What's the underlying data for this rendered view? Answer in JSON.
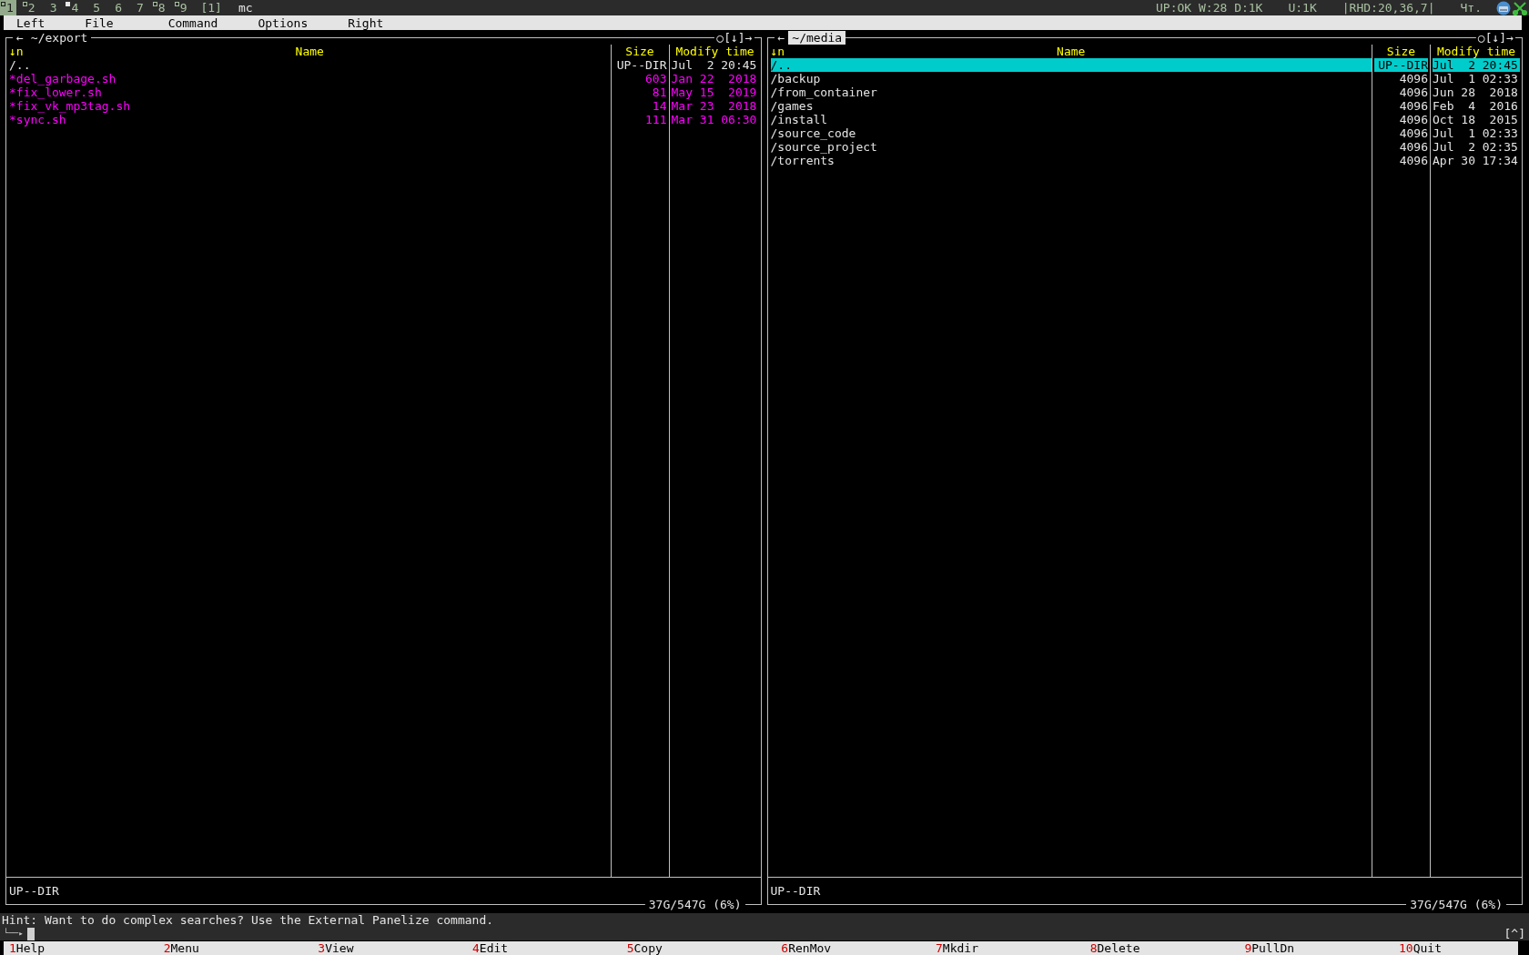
{
  "top_bar": {
    "workspaces": [
      {
        "label": "1",
        "selected": true,
        "occupied": true,
        "urgent": false
      },
      {
        "label": "2",
        "selected": false,
        "occupied": true,
        "urgent": false
      },
      {
        "label": "3",
        "selected": false,
        "occupied": false,
        "urgent": false
      },
      {
        "label": "4",
        "selected": false,
        "occupied": true,
        "urgent": true
      },
      {
        "label": "5",
        "selected": false,
        "occupied": false,
        "urgent": false
      },
      {
        "label": "6",
        "selected": false,
        "occupied": false,
        "urgent": false
      },
      {
        "label": "7",
        "selected": false,
        "occupied": false,
        "urgent": false
      },
      {
        "label": "8",
        "selected": false,
        "occupied": true,
        "urgent": false
      },
      {
        "label": "9",
        "selected": false,
        "occupied": true,
        "urgent": false
      }
    ],
    "layout": "[1]",
    "title": "mc",
    "status": [
      "UP:OK W:28 D:1K",
      "U:1K",
      "|RHD:20,36,7|",
      "Чт."
    ]
  },
  "menu": [
    "Left",
    "File",
    "Command",
    "Options",
    "Right"
  ],
  "panels": [
    {
      "path": "~/export",
      "active": false,
      "left_button": "←",
      "right_buttons": "○[↓]→",
      "sort": "↓n",
      "columns": [
        "Name",
        "Size",
        "Modify time"
      ],
      "rows": [
        {
          "name": "/..",
          "size": "UP--DIR",
          "modified": "Jul  2 20:45",
          "kind": "dir",
          "selected": false
        },
        {
          "name": "*del_garbage.sh",
          "size": "603",
          "modified": "Jan 22  2018",
          "kind": "executable",
          "selected": false
        },
        {
          "name": "*fix_lower.sh",
          "size": "81",
          "modified": "May 15  2019",
          "kind": "executable",
          "selected": false
        },
        {
          "name": "*fix_vk_mp3tag.sh",
          "size": "14",
          "modified": "Mar 23  2018",
          "kind": "executable",
          "selected": false
        },
        {
          "name": "*sync.sh",
          "size": "111",
          "modified": "Mar 31 06:30",
          "kind": "executable",
          "selected": false
        }
      ],
      "mini_status": "UP--DIR",
      "disk": "37G/547G (6%)"
    },
    {
      "path": "~/media",
      "active": true,
      "left_button": "←",
      "right_buttons": "○[↓]→",
      "sort": "↓n",
      "columns": [
        "Name",
        "Size",
        "Modify time"
      ],
      "rows": [
        {
          "name": "/..",
          "size": "UP--DIR",
          "modified": "Jul  2 20:45",
          "kind": "dir",
          "selected": true
        },
        {
          "name": "/backup",
          "size": "4096",
          "modified": "Jul  1 02:33",
          "kind": "dir",
          "selected": false
        },
        {
          "name": "/from_container",
          "size": "4096",
          "modified": "Jun 28  2018",
          "kind": "dir",
          "selected": false
        },
        {
          "name": "/games",
          "size": "4096",
          "modified": "Feb  4  2016",
          "kind": "dir",
          "selected": false
        },
        {
          "name": "/install",
          "size": "4096",
          "modified": "Oct 18  2015",
          "kind": "dir",
          "selected": false
        },
        {
          "name": "/source_code",
          "size": "4096",
          "modified": "Jul  1 02:33",
          "kind": "dir",
          "selected": false
        },
        {
          "name": "/source_project",
          "size": "4096",
          "modified": "Jul  2 02:35",
          "kind": "dir",
          "selected": false
        },
        {
          "name": "/torrents",
          "size": "4096",
          "modified": "Apr 30 17:34",
          "kind": "dir",
          "selected": false
        }
      ],
      "mini_status": "UP--DIR",
      "disk": "37G/547G (6%)"
    }
  ],
  "hint": "Hint: Want to do complex searches? Use the External Panelize command.",
  "command_line": {
    "prompt": "└──▸",
    "collapse": "[^]"
  },
  "keys": [
    {
      "num": "1",
      "label": "Help"
    },
    {
      "num": "2",
      "label": "Menu"
    },
    {
      "num": "3",
      "label": "View"
    },
    {
      "num": "4",
      "label": "Edit"
    },
    {
      "num": "5",
      "label": "Copy"
    },
    {
      "num": "6",
      "label": "RenMov"
    },
    {
      "num": "7",
      "label": "Mkdir"
    },
    {
      "num": "8",
      "label": "Delete"
    },
    {
      "num": "9",
      "label": "PullDn"
    },
    {
      "num": "10",
      "label": "Quit"
    }
  ]
}
